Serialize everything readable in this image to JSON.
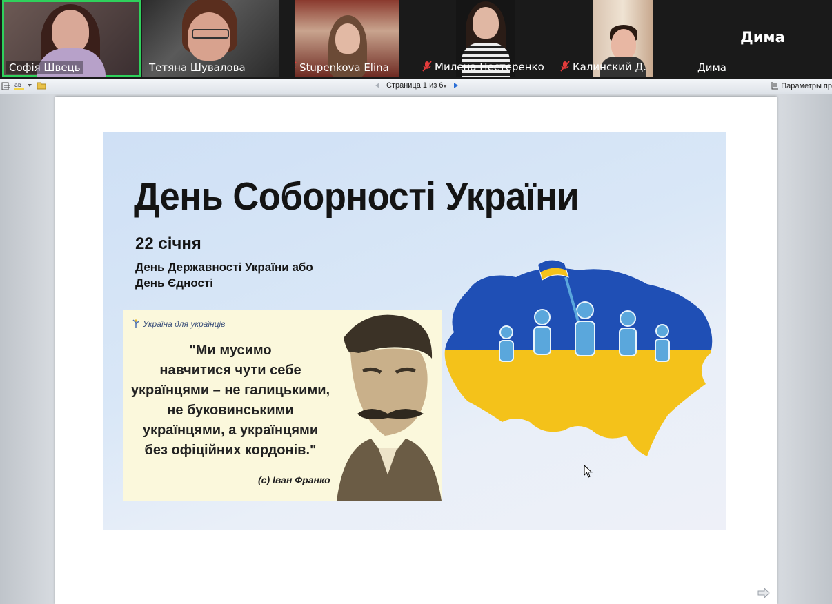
{
  "participants": [
    {
      "name": "Софія Швець",
      "muted": false,
      "active": true
    },
    {
      "name": "Тетяна Шувалова",
      "muted": false,
      "active": false
    },
    {
      "name": "Stupenkova Elina",
      "muted": true,
      "active": false
    },
    {
      "name": "Милена Нестеренко",
      "muted": true,
      "active": false
    },
    {
      "name": "Калинский Д.",
      "muted": true,
      "active": false
    },
    {
      "name": "Дима",
      "muted": false,
      "active": false,
      "big_label": "Дима"
    }
  ],
  "toolbar": {
    "page_indicator": "Страница 1 из 6",
    "params_label": "Параметры пр"
  },
  "slide": {
    "title": "День Соборності України",
    "date": "22 січня",
    "subtitle_line1": "День Державності України або",
    "subtitle_line2": "День Єдності",
    "brand": "Україна для українців",
    "quote_lines": [
      "\"Ми мусимо",
      "навчитися чути себе",
      "українцями – не галицькими,",
      "не буковинськими",
      "українцями, а українцями",
      "без офіційних кордонів.\""
    ],
    "author": "(с) Іван Франко"
  },
  "colors": {
    "flag_blue": "#1f4fb5",
    "flag_yellow": "#f4c21a",
    "active_border": "#2fd15c"
  }
}
